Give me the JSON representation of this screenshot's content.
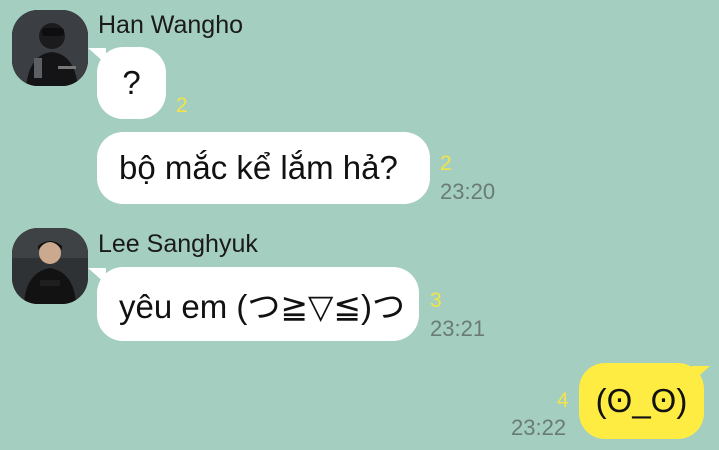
{
  "colors": {
    "background": "#a4cec0",
    "incoming_bubble": "#ffffff",
    "outgoing_bubble": "#ffec42",
    "read_count": "#f3e34a",
    "timestamp": "#6a7b76"
  },
  "messages": [
    {
      "sender": "Han Wangho",
      "avatar_icon": "profile-photo-icon",
      "bubbles": [
        {
          "text": "?",
          "unread_count": "2",
          "time": ""
        },
        {
          "text": "bộ mắc kể lắm hả?",
          "unread_count": "2",
          "time": "23:20"
        }
      ]
    },
    {
      "sender": "Lee Sanghyuk",
      "avatar_icon": "profile-photo-icon",
      "bubbles": [
        {
          "text": "yêu em (つ≧▽≦)つ",
          "unread_count": "3",
          "time": "23:21"
        }
      ]
    },
    {
      "sender": "",
      "outgoing": true,
      "bubbles": [
        {
          "text": "(ʘ_ʘ)",
          "unread_count": "4",
          "time": "23:22"
        }
      ]
    }
  ]
}
